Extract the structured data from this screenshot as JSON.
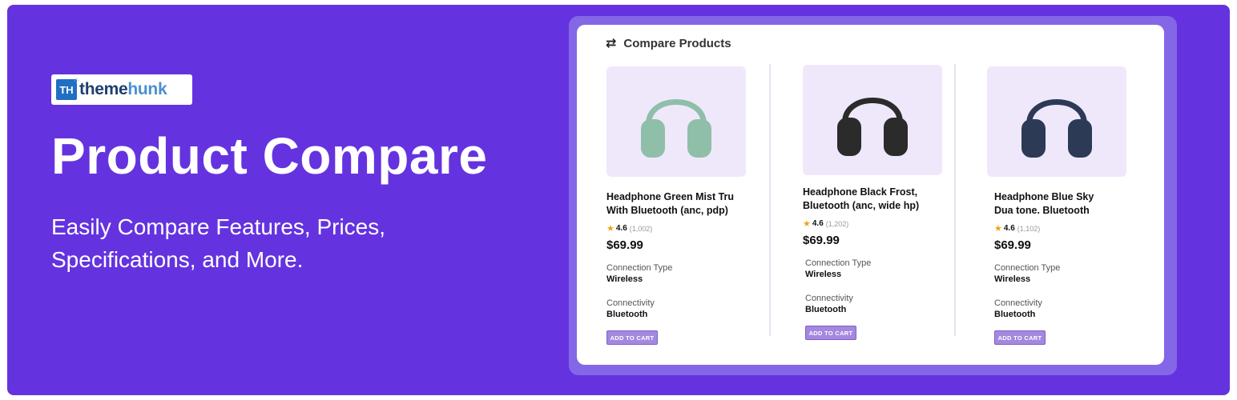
{
  "banner": {
    "logo": {
      "mark": "TH",
      "text_part1": "theme",
      "text_part2": "hunk"
    },
    "headline": "Product Compare",
    "subheadline": "Easily Compare Features, Prices, Specifications, and More."
  },
  "compare": {
    "title": "Compare Products",
    "title_icon": "swap-arrows-icon",
    "products": [
      {
        "name": "Headphone Green Mist Tru With Bluetooth (anc, pdp)",
        "color": "#8fbfa8",
        "rating": "4.6",
        "rating_count": "(1,002)",
        "price": "$69.99",
        "specs": [
          {
            "label": "Connection Type",
            "value": "Wireless"
          },
          {
            "label": "Connectivity",
            "value": "Bluetooth"
          }
        ],
        "cart_label": "ADD TO CART"
      },
      {
        "name": "Headphone Black Frost, Bluetooth (anc, wide hp)",
        "color": "#2b2b2b",
        "rating": "4.6",
        "rating_count": "(1,202)",
        "price": "$69.99",
        "specs": [
          {
            "label": "Connection Type",
            "value": "Wireless"
          },
          {
            "label": "Connectivity",
            "value": "Bluetooth"
          }
        ],
        "cart_label": "ADD TO CART"
      },
      {
        "name": "Headphone Blue Sky Dua tone. Bluetooth",
        "color": "#2d3a55",
        "rating": "4.6",
        "rating_count": "(1,102)",
        "price": "$69.99",
        "specs": [
          {
            "label": "Connection Type",
            "value": "Wireless"
          },
          {
            "label": "Connectivity",
            "value": "Bluetooth"
          }
        ],
        "cart_label": "ADD TO CART"
      }
    ]
  }
}
